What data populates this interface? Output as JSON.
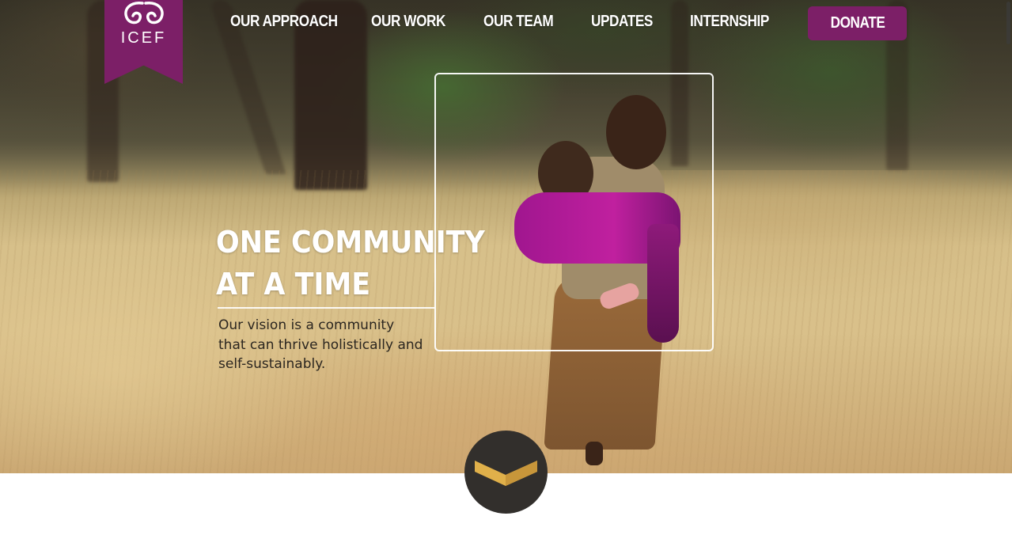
{
  "brand": {
    "logo_text": "ICEF",
    "logo_icon": "ornament-icon",
    "brand_color": "#7c1f67"
  },
  "nav": {
    "items": [
      {
        "label": "OUR APPROACH"
      },
      {
        "label": "OUR WORK"
      },
      {
        "label": "OUR TEAM"
      },
      {
        "label": "UPDATES"
      },
      {
        "label": "INTERNSHIP"
      }
    ],
    "donate_label": "DONATE"
  },
  "hero": {
    "headline_line1": "ONE COMMUNITY",
    "headline_line2": "AT A TIME",
    "tagline": "Our vision is a community that can thrive holistically and self-sustainably.",
    "image_subject": "child-carrying-toddler-in-grass-field"
  },
  "scroll_button": {
    "icon": "chevron-down-icon",
    "icon_color": "#e0b04a",
    "background_color": "#322f2c"
  }
}
